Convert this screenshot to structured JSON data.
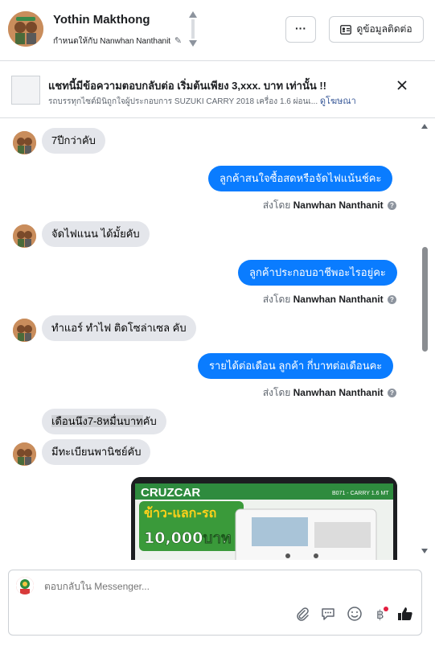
{
  "header": {
    "name": "Yothin Makthong",
    "assigned_label": "กำหนดให้กับ",
    "assigned_name": "Nanwhan Nanthanit",
    "more_label": "···",
    "contact_button": "ดูข้อมูลติดต่อ"
  },
  "ad": {
    "title": "แชทนี้มีข้อความตอบกลับต่อ เริ่มต้นเพียง 3,xxx. บาท เท่านั้น !!",
    "subtitle": "รถบรรทุกไซต์มินิถูกใจผู้ประกอบการ SUZUKI CARRY 2018 เครื่อง 1.6 ผ่อนเ...",
    "link": "ดูโฆษณา"
  },
  "messages": {
    "m1": "7ปีกว่าคับ",
    "m2": "ลูกค้าสนใจซื้อสดหรือจัดไฟแน้นช์คะ",
    "m3": "จัดไฟแนน  ได้มั้ยคับ",
    "m4": "ลูกค้าประกอบอาชีพอะไรอยู่คะ",
    "m5": "ทำแอร์ ทำไฟ ติดโซล่าเซล คับ",
    "m6": "รายได้ต่อเดือน ลูกค้า กี่บาทต่อเดือนคะ",
    "m7_highlight": "เดือนนึง7-8หมื่นบาท",
    "m7_rest": "คับ",
    "m8": "มีทะเบียนพานิชย์คับ",
    "sent_by_label": "ส่งโดย",
    "sent_by_name": "Nanwhan Nanthanit"
  },
  "promo_image": {
    "brand": "CRUZCAR",
    "headline": "ข้าว-แลก-รถ",
    "amount": "10,000บาท",
    "tag": "B071 - CARRY 1.6 MT"
  },
  "composer": {
    "placeholder": "ตอบกลับใน Messenger..."
  },
  "colors": {
    "outgoing_bubble": "#0a7cff",
    "incoming_bubble": "#e4e6eb",
    "link": "#385898"
  }
}
